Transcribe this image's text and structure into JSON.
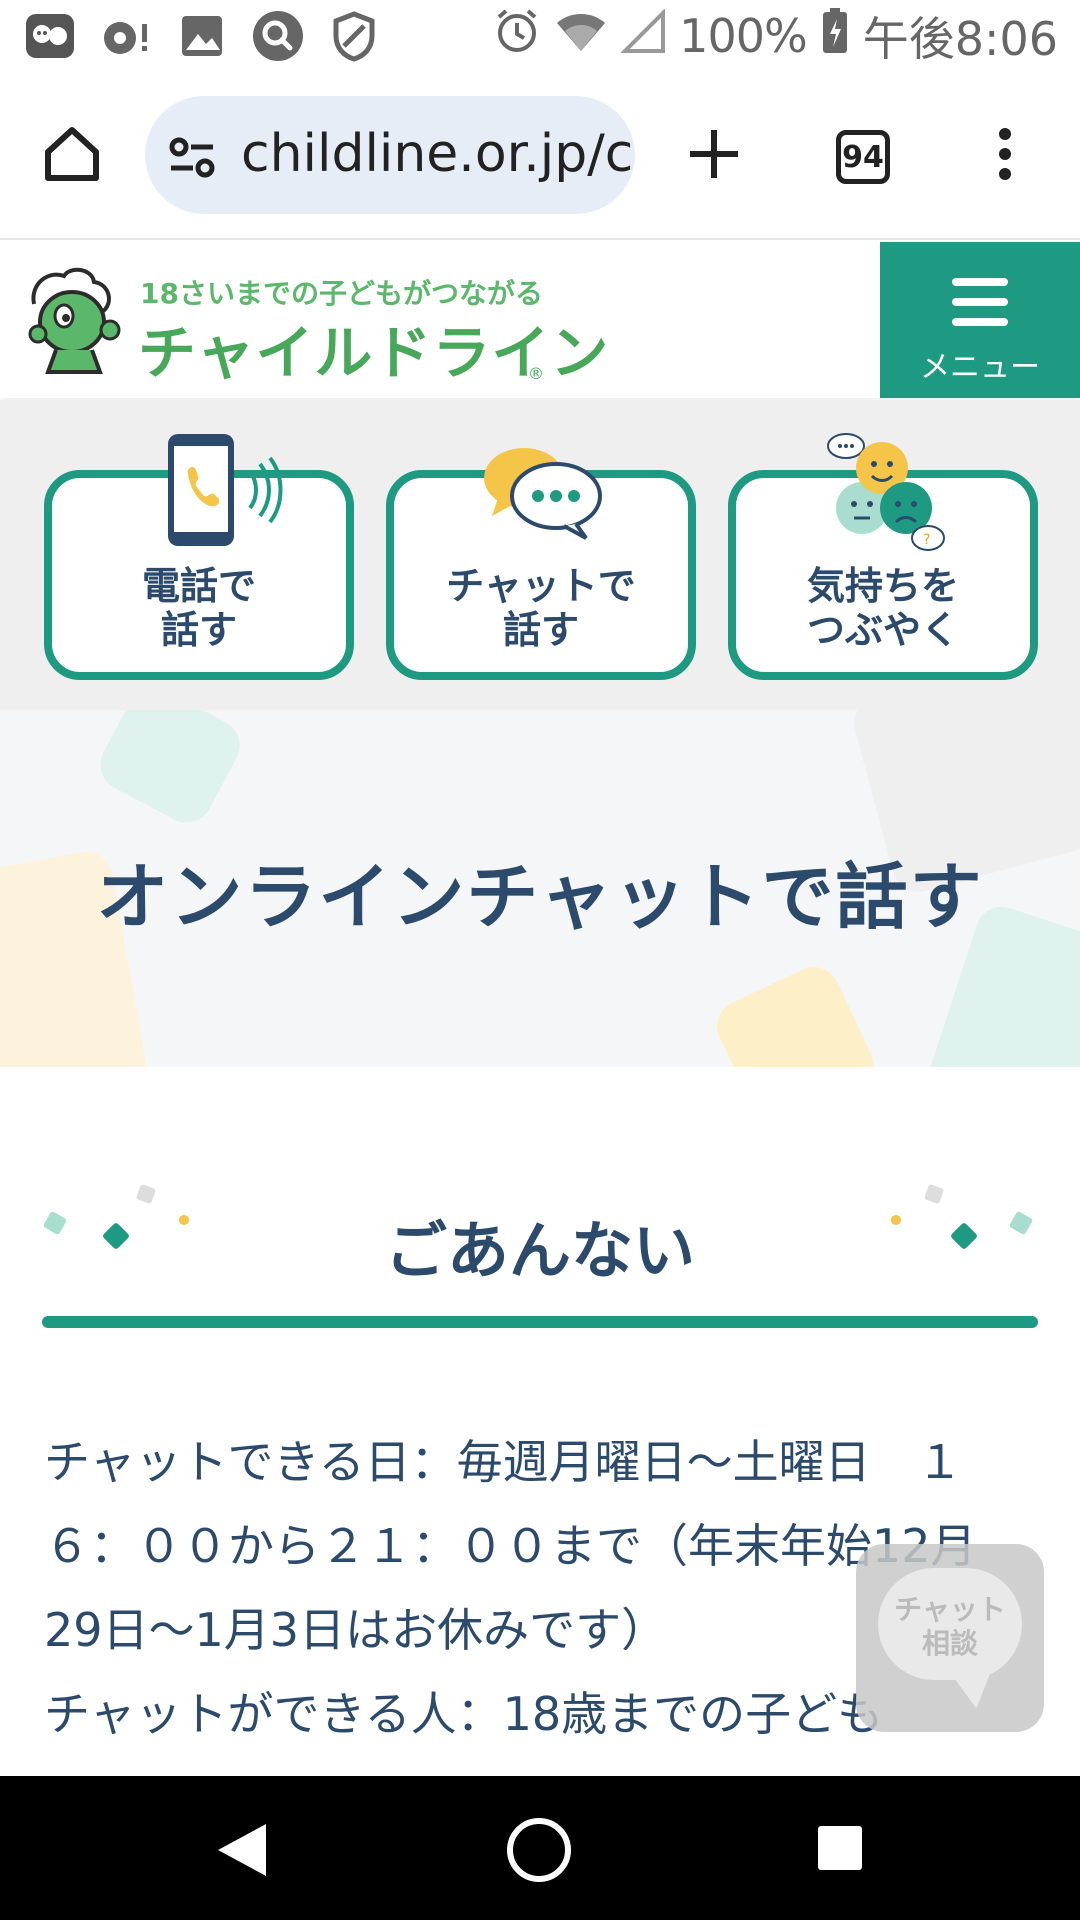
{
  "status_bar": {
    "icons": [
      "chat-app-icon",
      "notification-badge-icon",
      "photo-icon",
      "search-app-icon",
      "shield-icon",
      "alarm-icon",
      "wifi-icon",
      "signal-icon"
    ],
    "battery": "100%",
    "time": "午後8:06"
  },
  "browser": {
    "url": "childline.or.jp/c",
    "tab_count": "94"
  },
  "site_header": {
    "tagline": "18さいまでの子どもがつながる",
    "brand": "チャイルドライン",
    "registered": "®",
    "menu_label": "メニュー",
    "accent_color": "#1e9a83"
  },
  "nav_cards": [
    {
      "line1": "電話で",
      "line2": "話す",
      "icon": "phone-call-icon"
    },
    {
      "line1": "チャットで",
      "line2": "話す",
      "icon": "chat-bubbles-icon"
    },
    {
      "line1": "気持ちを",
      "line2": "つぶやく",
      "icon": "faces-icon"
    }
  ],
  "hero": {
    "title": "オンラインチャットで話す"
  },
  "section": {
    "heading": "ごあんない"
  },
  "body": {
    "line1": "チャットできる日：毎週月曜日〜土曜日　１",
    "line2": "６：００から２１：００まで（年末年始12月",
    "line3": "29日〜1月3日はお休みです）",
    "line4": "チャットができる人：18歳までの子ども"
  },
  "chat_fab": {
    "line1": "チャット",
    "line2": "相談"
  }
}
